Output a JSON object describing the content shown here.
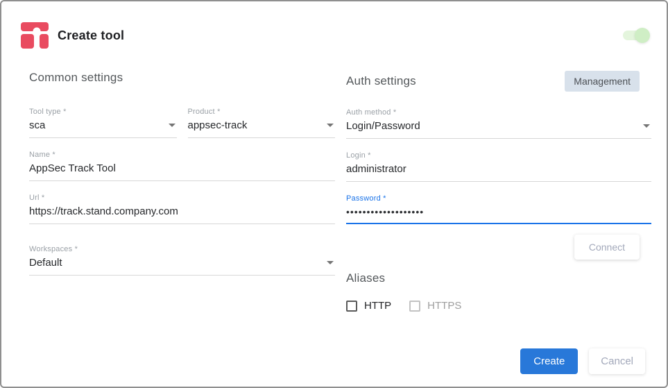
{
  "dialog": {
    "title": "Create tool",
    "toggle_state": "on"
  },
  "common": {
    "heading": "Common settings",
    "tool_type": {
      "label": "Tool type *",
      "value": "sca"
    },
    "product": {
      "label": "Product *",
      "value": "appsec-track"
    },
    "name": {
      "label": "Name *",
      "value": "AppSec Track Tool"
    },
    "url": {
      "label": "Url *",
      "value": "https://track.stand.company.com"
    },
    "workspaces": {
      "label": "Workspaces *",
      "value": "Default"
    }
  },
  "auth": {
    "heading": "Auth settings",
    "management_button": "Management",
    "auth_method": {
      "label": "Auth method *",
      "value": "Login/Password"
    },
    "login": {
      "label": "Login *",
      "value": "administrator"
    },
    "password": {
      "label": "Password *",
      "masked_value": "•••••••••••••••••••"
    },
    "connect_button": "Connect"
  },
  "aliases": {
    "heading": "Aliases",
    "options": [
      {
        "label": "HTTP",
        "checked": false,
        "enabled": true
      },
      {
        "label": "HTTPS",
        "checked": false,
        "enabled": false
      }
    ]
  },
  "footer": {
    "create_button": "Create",
    "cancel_button": "Cancel"
  },
  "colors": {
    "brand_red": "#e94b60",
    "accent_blue": "#2878d9",
    "focus_blue": "#1a73e8",
    "management_bg": "#d8e1eb",
    "toggle_green": "#cfeec5",
    "underline_gray": "#d7d7d7"
  }
}
